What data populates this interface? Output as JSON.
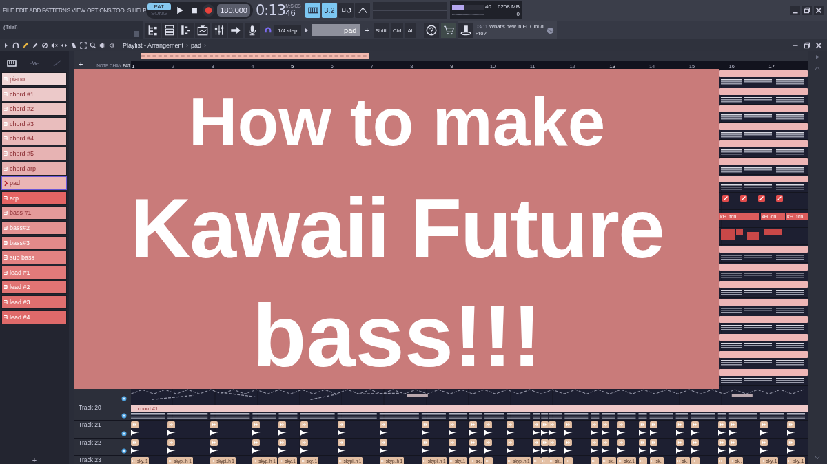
{
  "menu": [
    "FILE",
    "EDIT",
    "ADD",
    "PATTERNS",
    "VIEW",
    "OPTIONS",
    "TOOLS",
    "HELP"
  ],
  "transport": {
    "modes": [
      {
        "label": "PAT",
        "selected": true
      },
      {
        "label": "SONG",
        "selected": false
      }
    ],
    "tempo": "180.000"
  },
  "clock": {
    "time": "0:13",
    "centis": "46",
    "unit": "M:S:CS"
  },
  "mode_buttons": [
    {
      "kind": "keyboard",
      "on": true
    },
    {
      "kind": "text",
      "label": "3.2",
      "on": true
    },
    {
      "kind": "loop",
      "on": false
    },
    {
      "kind": "metronome",
      "on": false
    }
  ],
  "cpu": {
    "level": 0.4,
    "reading": "40",
    "memory": "6208 MB",
    "voices": "0"
  },
  "trial": "(Trial)",
  "snap": "1/4 step",
  "pattern_field": "pad",
  "pattern_add": "+",
  "modifiers": [
    "Shift",
    "Ctrl",
    "Alt"
  ],
  "hint": {
    "date": "03/11",
    "text": "What's new in FL Cloud Pro?"
  },
  "breadcrumb": [
    "Playlist - Arrangement",
    "›",
    "pad",
    "›"
  ],
  "picker_tabs": [
    {
      "label": "NOTE",
      "selected": false
    },
    {
      "label": "CHAN",
      "selected": false
    },
    {
      "label": "PAT",
      "selected": true
    }
  ],
  "track_add": "+",
  "ruler": [
    "1",
    "2",
    "3",
    "4",
    "5",
    "6",
    "7",
    "8",
    "9",
    "10",
    "11",
    "12",
    "13",
    "14",
    "15",
    "16",
    "17"
  ],
  "patterns": [
    {
      "name": "piano",
      "color": "#efd6d6",
      "selected": false
    },
    {
      "name": "chord #1",
      "color": "#ecc9c9",
      "selected": false
    },
    {
      "name": "chord #2",
      "color": "#eac3c3",
      "selected": false
    },
    {
      "name": "chord #3",
      "color": "#e9bdbd",
      "selected": false
    },
    {
      "name": "chord #4",
      "color": "#e8b8b8",
      "selected": false
    },
    {
      "name": "chord #5",
      "color": "#e7b3b3",
      "selected": false
    },
    {
      "name": "chord arp",
      "color": "#e6aeae",
      "selected": false
    },
    {
      "name": "pad",
      "color": "#eab5b5",
      "selected": true
    },
    {
      "name": "arp",
      "color": "#e46464",
      "selected": false
    },
    {
      "name": "bass #1",
      "color": "#e59a9a",
      "selected": false
    },
    {
      "name": "bass#2",
      "color": "#e49292",
      "selected": false
    },
    {
      "name": "bass#3",
      "color": "#e38a8a",
      "selected": false
    },
    {
      "name": "sub bass",
      "color": "#e38282",
      "selected": false
    },
    {
      "name": "lead #1",
      "color": "#e27a7a",
      "selected": false
    },
    {
      "name": "lead #2",
      "color": "#e17474",
      "selected": false
    },
    {
      "name": "lead #3",
      "color": "#e06f6f",
      "selected": false
    },
    {
      "name": "lead #4",
      "color": "#df6a6a",
      "selected": false
    }
  ],
  "pattern_list_add": "+",
  "strip_rows": [
    {
      "kind": "pattern"
    },
    {
      "kind": "pattern"
    },
    {
      "kind": "pattern"
    },
    {
      "kind": "pattern"
    },
    {
      "kind": "pattern"
    },
    {
      "kind": "pattern"
    },
    {
      "kind": "pattern"
    },
    {
      "kind": "automation"
    },
    {
      "kind": "audio",
      "labels": [
        "kH..tch",
        "kH..ch",
        "kH..tch"
      ]
    },
    {
      "kind": "block"
    },
    {
      "kind": "pattern"
    },
    {
      "kind": "pattern"
    },
    {
      "kind": "pattern"
    },
    {
      "kind": "pattern"
    },
    {
      "kind": "pattern"
    },
    {
      "kind": "pattern"
    },
    {
      "kind": "pattern"
    },
    {
      "kind": "pattern"
    }
  ],
  "tracks": [
    {
      "kind": "automation"
    },
    {
      "kind": "pattern",
      "name": "Track 20",
      "clip_label": "chord #1"
    },
    {
      "kind": "audio",
      "name": "Track 21"
    },
    {
      "kind": "audio",
      "name": "Track 22"
    },
    {
      "kind": "labeled",
      "name": "Track 23",
      "clips": [
        {
          "label": "sky..1"
        },
        {
          "label": "skypi..h 1"
        },
        {
          "label": "skypi..h 1"
        },
        {
          "label": "skyp..h 1"
        },
        {
          "label": "sky..1"
        },
        {
          "label": "sky..1"
        },
        {
          "label": "skypi..h 1"
        },
        {
          "label": "skyp..h 1"
        },
        {
          "label": "skypi..h 1"
        },
        {
          "label": "sky..1"
        },
        {
          "label": "sk.."
        },
        {
          "kind": "short"
        },
        {
          "label": "skyp..h 1"
        },
        {
          "kind": "short"
        },
        {
          "kind": "short"
        },
        {
          "label": "sk.."
        },
        {
          "kind": "short"
        },
        {
          "kind": "short"
        },
        {
          "label": "sk.."
        },
        {
          "label": "sky..1"
        },
        {
          "kind": "short"
        },
        {
          "label": "sk.."
        },
        {
          "label": "sk.."
        },
        {
          "kind": "short"
        },
        {
          "kind": "short"
        },
        {
          "label": "sk.."
        },
        {
          "label": "sky..1"
        },
        {
          "label": "sky..1"
        }
      ]
    }
  ],
  "banner": {
    "lines": [
      "How to make",
      "Kawaii Future",
      "bass!!!"
    ]
  }
}
